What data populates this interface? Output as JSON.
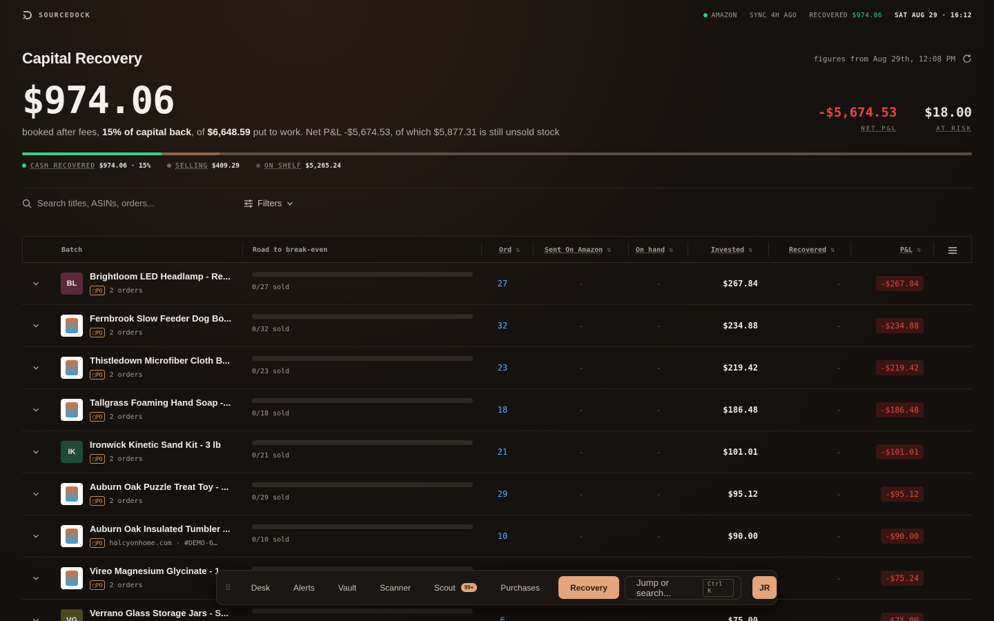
{
  "brand": "SOURCEDOCK",
  "status": {
    "marketplace": "AMAZON",
    "sync": "SYNC 4H AGO",
    "recovered_label": "RECOVERED",
    "recovered_value": "$974.06",
    "datetime": "SAT AUG 29 · 16:12"
  },
  "page_title": "Capital Recovery",
  "figures_note": "figures from Aug 29th, 12:08 PM",
  "big_value": "$974.06",
  "summary": {
    "p1": "booked after fees,",
    "p2": "15% of capital back",
    "p3": ", of",
    "p4": "$6,648.59",
    "p5": "put to work. Net P&L -$5,674.53, of which $5,877.31 is still unsold stock"
  },
  "kpis": [
    {
      "value": "-$5,674.53",
      "label": "NET P&L",
      "color": "#e0473e"
    },
    {
      "value": "$18.00",
      "label": "AT RISK",
      "color": "#f2ede7"
    }
  ],
  "progress": {
    "cash_pct": 14.65,
    "selling_pct": 6.15
  },
  "legend": [
    {
      "key": "CASH RECOVERED",
      "value": "$974.06 · 15%",
      "color": "#3ccf8e"
    },
    {
      "key": "SELLING",
      "value": "$409.29",
      "color": "#8a6a4f"
    },
    {
      "key": "ON SHELF",
      "value": "$5,265.24",
      "color": "#5a4e45"
    }
  ],
  "search_placeholder": "Search titles, ASINs, orders...",
  "filters_label": "Filters",
  "columns": {
    "batch": "Batch",
    "road": "Road to break-even",
    "ord": "Ord",
    "sent": "Sent On Amazon",
    "onhand": "On hand",
    "invested": "Invested",
    "recovered": "Recovered",
    "pnl": "P&L"
  },
  "rows": [
    {
      "title": "Brightloom LED Headlamp - Re...",
      "meta": "2 orders",
      "sold": "0/27 sold",
      "ord": "27",
      "sent": "-",
      "onhand": "-",
      "invested": "$267.84",
      "recovered": "-",
      "pnl": "-$267.84",
      "thumb": "BL",
      "thumb_bg": "#5b2a3a"
    },
    {
      "title": "Fernbrook Slow Feeder Dog Bo...",
      "meta": "2 orders",
      "sold": "0/32 sold",
      "ord": "32",
      "sent": "-",
      "onhand": "-",
      "invested": "$234.88",
      "recovered": "-",
      "pnl": "-$234.88",
      "thumb": "",
      "thumb_bg": "#ffffff"
    },
    {
      "title": "Thistledown Microfiber Cloth B...",
      "meta": "2 orders",
      "sold": "0/23 sold",
      "ord": "23",
      "sent": "-",
      "onhand": "-",
      "invested": "$219.42",
      "recovered": "-",
      "pnl": "-$219.42",
      "thumb": "",
      "thumb_bg": "#ffffff"
    },
    {
      "title": "Tallgrass Foaming Hand Soap -...",
      "meta": "2 orders",
      "sold": "0/18 sold",
      "ord": "18",
      "sent": "-",
      "onhand": "-",
      "invested": "$186.48",
      "recovered": "-",
      "pnl": "-$186.48",
      "thumb": "",
      "thumb_bg": "#ffffff"
    },
    {
      "title": "Ironwick Kinetic Sand Kit - 3 lb",
      "meta": "2 orders",
      "sold": "0/21 sold",
      "ord": "21",
      "sent": "-",
      "onhand": "-",
      "invested": "$101.01",
      "recovered": "-",
      "pnl": "-$101.01",
      "thumb": "IK",
      "thumb_bg": "#1f4a38"
    },
    {
      "title": "Auburn Oak Puzzle Treat Toy - ...",
      "meta": "2 orders",
      "sold": "0/29 sold",
      "ord": "29",
      "sent": "-",
      "onhand": "-",
      "invested": "$95.12",
      "recovered": "-",
      "pnl": "-$95.12",
      "thumb": "",
      "thumb_bg": "#ffffff"
    },
    {
      "title": "Auburn Oak Insulated Tumbler ...",
      "meta": "halcyonhome.com · #DEMO-6…",
      "sold": "0/10 sold",
      "ord": "10",
      "sent": "-",
      "onhand": "-",
      "invested": "$90.00",
      "recovered": "-",
      "pnl": "-$90.00",
      "thumb": "",
      "thumb_bg": "#ffffff"
    },
    {
      "title": "Vireo Magnesium Glycinate - 1...",
      "meta": "2 orders",
      "sold": "",
      "ord": "",
      "sent": "",
      "onhand": "",
      "invested": "",
      "recovered": "-",
      "pnl": "-$75.24",
      "thumb": "",
      "thumb_bg": "#ffffff"
    },
    {
      "title": "Verrano Glass Storage Jars - S...",
      "meta": "",
      "sold": "",
      "ord": "6",
      "sent": "",
      "onhand": "",
      "invested": "$75.00",
      "recovered": "",
      "pnl": "-$75.00",
      "thumb": "VG",
      "thumb_bg": "#4a4a20"
    }
  ],
  "dock": {
    "items": [
      "Desk",
      "Alerts",
      "Vault",
      "Scanner",
      "Scout",
      "Purchases",
      "Recovery"
    ],
    "scout_badge": "99+",
    "active": "Recovery",
    "jump_placeholder": "Jump or search...",
    "shortcut": "Ctrl K",
    "avatar": "JR"
  }
}
